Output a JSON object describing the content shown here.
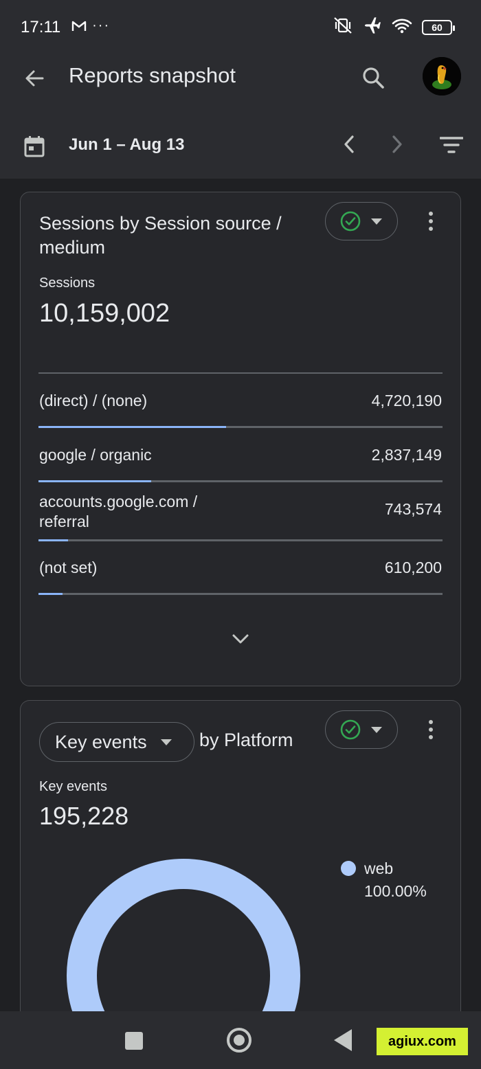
{
  "status_bar": {
    "time": "17:11",
    "left_icons": [
      "gmail-icon",
      "more-icon"
    ],
    "battery": "60",
    "right_icons": [
      "mute-vibrate-icon",
      "airplane-icon",
      "wifi-icon",
      "battery-icon"
    ]
  },
  "app_bar": {
    "title": "Reports snapshot",
    "back_icon": "arrow-back-icon",
    "search_icon": "search-icon",
    "avatar_icon": "avatar"
  },
  "date_bar": {
    "range": "Jun 1 – Aug 13",
    "calendar_icon": "calendar-icon",
    "prev_icon": "chevron-left-icon",
    "next_icon": "chevron-right-icon",
    "filter_icon": "filter-icon"
  },
  "sessions_card": {
    "title": "Sessions by Session source / medium",
    "status_icon": "check-circle-icon",
    "metric_label": "Sessions",
    "metric_value": "10,159,002",
    "rows": [
      {
        "label": "(direct) / (none)",
        "value": "4,720,190",
        "share": 0.4646
      },
      {
        "label": "google / organic",
        "value": "2,837,149",
        "share": 0.2793
      },
      {
        "label": "accounts.google.com / referral",
        "value": "743,574",
        "share": 0.0732
      },
      {
        "label": "(not set)",
        "value": "610,200",
        "share": 0.0601
      }
    ],
    "expand_icon": "chevron-down-icon"
  },
  "key_events_card": {
    "metric_dropdown": "Key events",
    "title_suffix": "by Platform",
    "status_icon": "check-circle-icon",
    "metric_label": "Key events",
    "metric_value": "195,228",
    "legend": [
      {
        "name": "web",
        "percent": "100.00%",
        "share": 1.0,
        "color": "#aecbfa"
      }
    ]
  },
  "colors": {
    "accent": "#8ab4f8",
    "donut": "#aecbfa",
    "check": "#34a853",
    "watermark": "#d4f032"
  },
  "nav_bar": {
    "recents_icon": "recents-icon",
    "home_icon": "home-icon",
    "back_icon": "nav-back-icon",
    "badge": "agiux.com"
  }
}
